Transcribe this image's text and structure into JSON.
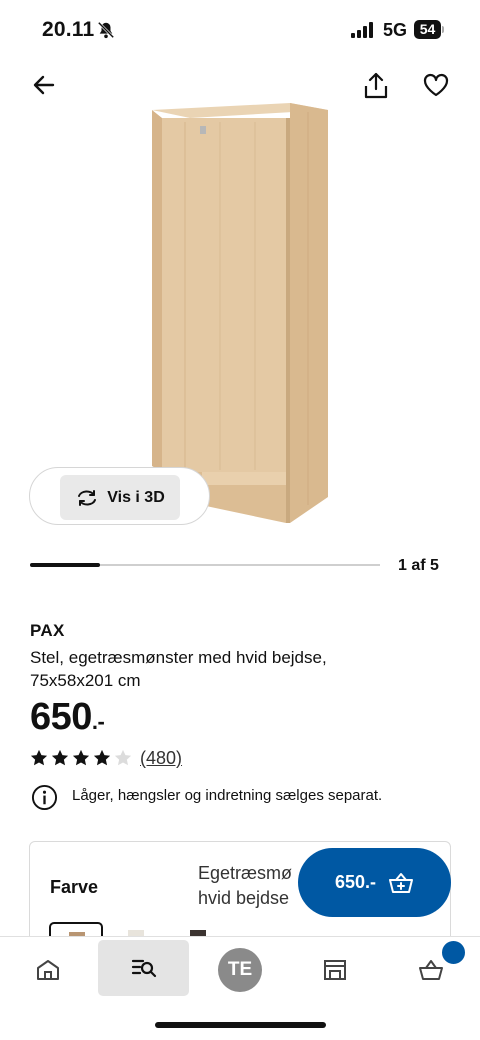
{
  "status_bar": {
    "time": "20.11",
    "network": "5G",
    "battery": "54"
  },
  "icons": {
    "back": "arrow-left",
    "share": "share-up-arrow",
    "favorite": "heart-outline",
    "rotate": "rotate-arrows",
    "info": "info-circle",
    "cart": "shopping-basket",
    "home": "home",
    "search": "search-list",
    "store": "store",
    "bell": "bell-slash"
  },
  "gallery": {
    "view_3d_label": "Vis i 3D",
    "page_indicator": "1 af 5",
    "current_page": 1,
    "total_pages": 5
  },
  "product": {
    "brand": "PAX",
    "description_line1": "Stel, egetræsmønster med hvid bejdse,",
    "description_line2": "75x58x201 cm",
    "price": "650",
    "price_suffix": ".-",
    "rating": 4,
    "rating_max": 5,
    "review_count": "(480)",
    "info_note": "Låger, hængsler og indretning sælges separat."
  },
  "color_section": {
    "label": "Farve",
    "selected_value_line1": "Egetræsmø",
    "selected_value_line2": "hvid bejdse"
  },
  "add_to_cart": {
    "label": "650.-"
  },
  "bottom_nav": {
    "profile_initials": "TE"
  },
  "colors": {
    "accent": "#0058a3",
    "wood": "#e4c9a4",
    "wood_dark": "#c9a97f"
  }
}
